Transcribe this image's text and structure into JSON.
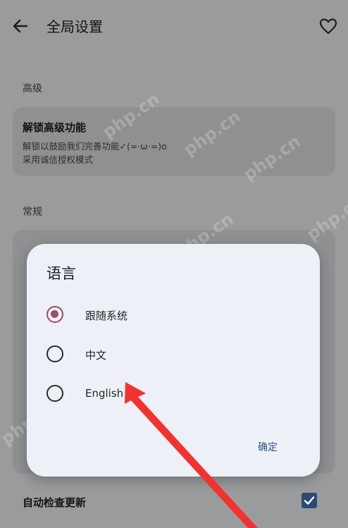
{
  "appbar": {
    "title": "全局设置"
  },
  "sections": {
    "advanced": {
      "label": "高级",
      "unlock_title": "解锁高级功能",
      "unlock_line1": "解锁以鼓励我们完善功能✓(=·ω·=)o",
      "unlock_line2": "采用诚信授权模式"
    },
    "general": {
      "label": "常规"
    }
  },
  "bottom_row": {
    "label": "自动检查更新",
    "checked": true
  },
  "dialog": {
    "title": "语言",
    "options": [
      {
        "label": "跟随系统",
        "selected": true
      },
      {
        "label": "中文",
        "selected": false
      },
      {
        "label": "English",
        "selected": false
      }
    ],
    "confirm_label": "确定"
  },
  "watermark": "php.cn",
  "colors": {
    "accent_radio": "#9c4b69",
    "confirm_text": "#28548f",
    "arrow": "#f2322e",
    "checkbox": "#2c4a73"
  }
}
